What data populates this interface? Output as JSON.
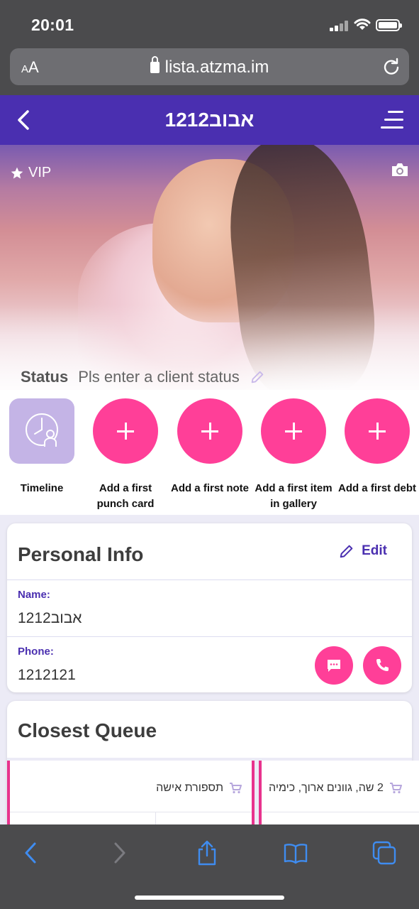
{
  "status_bar": {
    "time": "20:01"
  },
  "browser": {
    "text_size_label": "AA",
    "url": "lista.atzma.im"
  },
  "app_header": {
    "title": "אבוב1212"
  },
  "hero": {
    "vip_label": "VIP",
    "status_label": "Status",
    "status_placeholder": "Pls enter a client status"
  },
  "actions": [
    {
      "label": "Timeline",
      "icon": "timeline-icon"
    },
    {
      "label": "Add a first\npunch card",
      "icon": "plus-icon"
    },
    {
      "label": "Add a first note",
      "icon": "plus-icon"
    },
    {
      "label": "Add a first item\nin gallery",
      "icon": "plus-icon"
    },
    {
      "label": "Add a first debt",
      "icon": "plus-icon"
    }
  ],
  "personal_info": {
    "heading": "Personal Info",
    "edit_label": "Edit",
    "name_label": "Name:",
    "name_value": "אבוב1212",
    "phone_label": "Phone:",
    "phone_value": "1212121"
  },
  "closest_queue": {
    "heading": "Closest Queue",
    "items": [
      {
        "service": "תספורת אישה"
      },
      {
        "service": "2 שה, גוונים ארוך, כימיה"
      }
    ]
  },
  "colors": {
    "brand_purple": "#4a2fb0",
    "accent_pink": "#ff3f98",
    "timeline_lavender": "#c4b4e6"
  }
}
